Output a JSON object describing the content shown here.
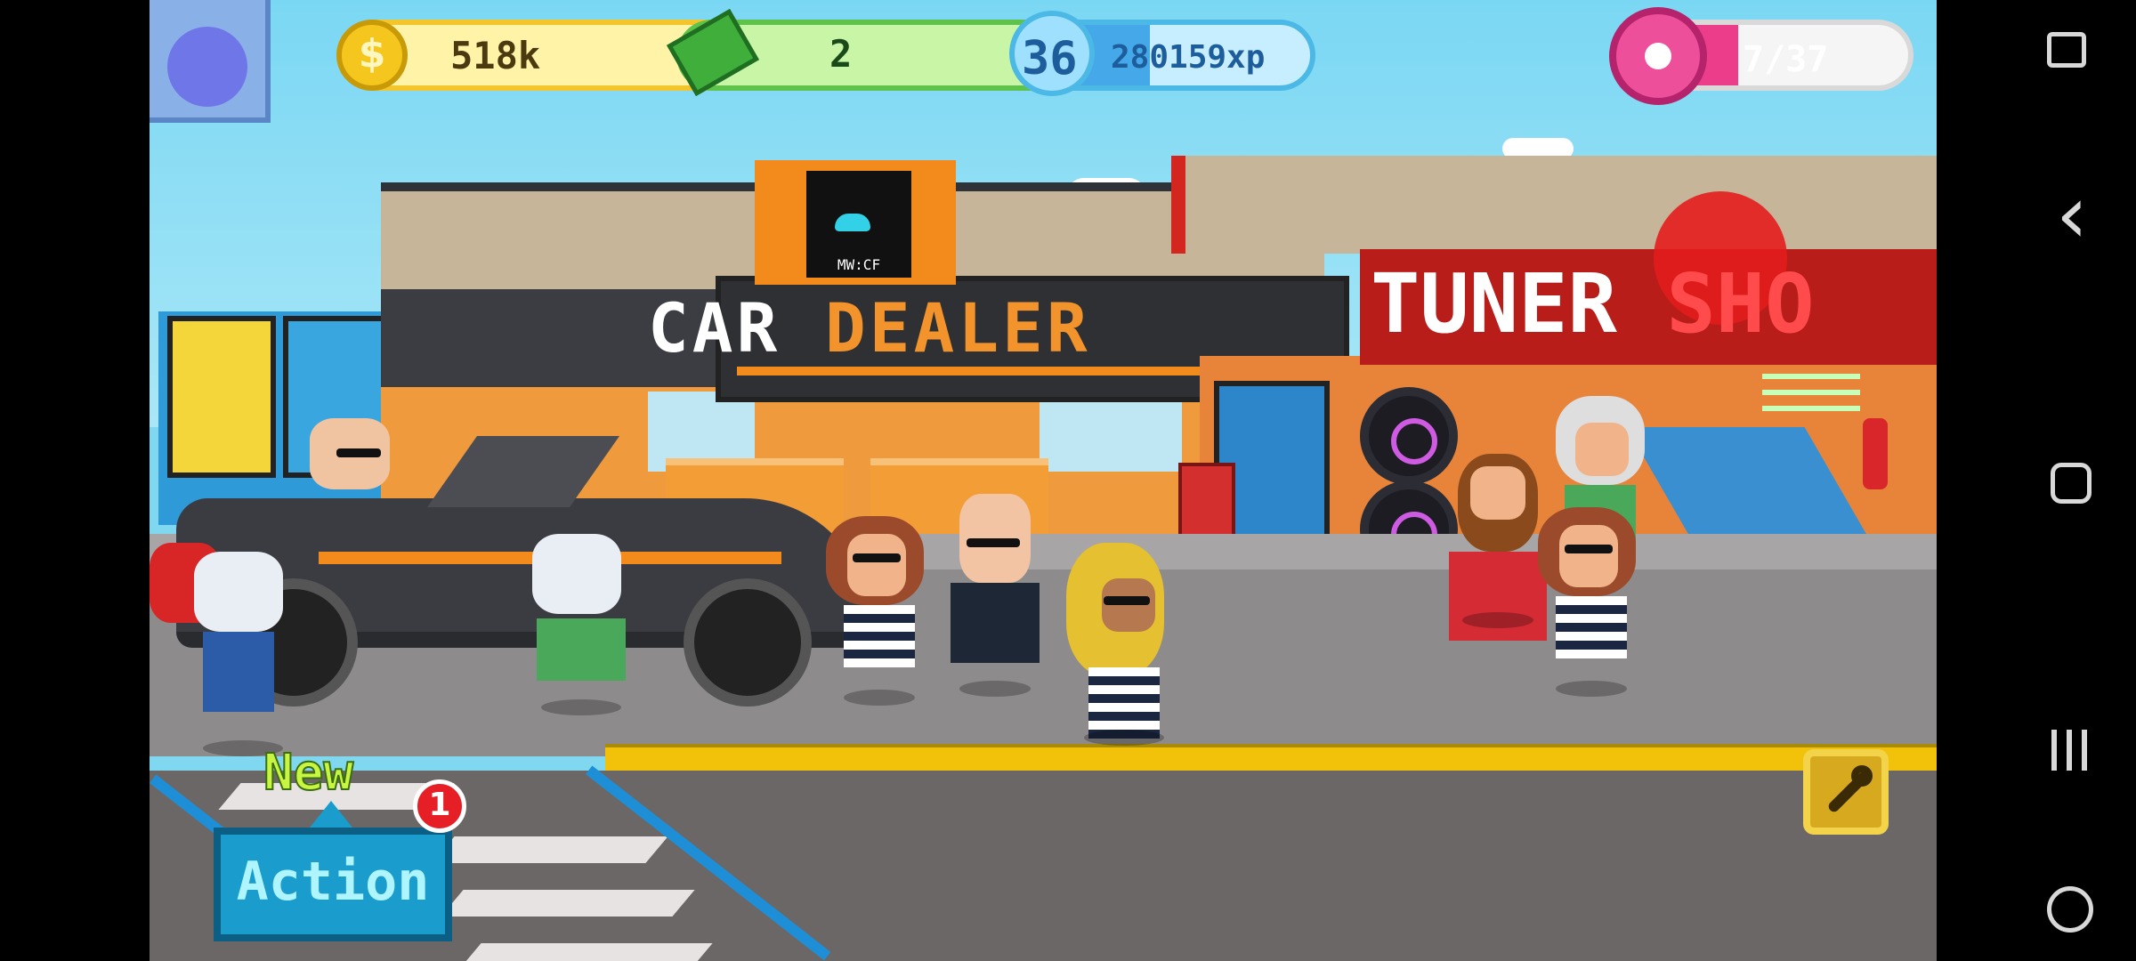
{
  "hud": {
    "coins": "518k",
    "cash": "2",
    "level": "36",
    "xp": "280159xp",
    "donuts": "7/37",
    "plus_symbol": "+",
    "xp_progress": 0.45
  },
  "buildings": {
    "dealer_sign_word1": "CAR",
    "dealer_sign_word2": "DEALER",
    "dealer_screen_label": "MW:CF",
    "tuner_sign_word1": "TUNER",
    "tuner_sign_word2": "SHO"
  },
  "actions": {
    "new_label": "New",
    "action_button": "Action",
    "notification_count": "1"
  },
  "nav": {
    "back": "‹",
    "gamepad": "🎮"
  },
  "colors": {
    "coin_pill": "#fff3a8",
    "cash_pill": "#c9f5a6",
    "xp_pill": "#9fe4ff",
    "donut_pill": "#ffd3e4",
    "accent_orange": "#f28a1c",
    "curb_yellow": "#f2c20b"
  }
}
